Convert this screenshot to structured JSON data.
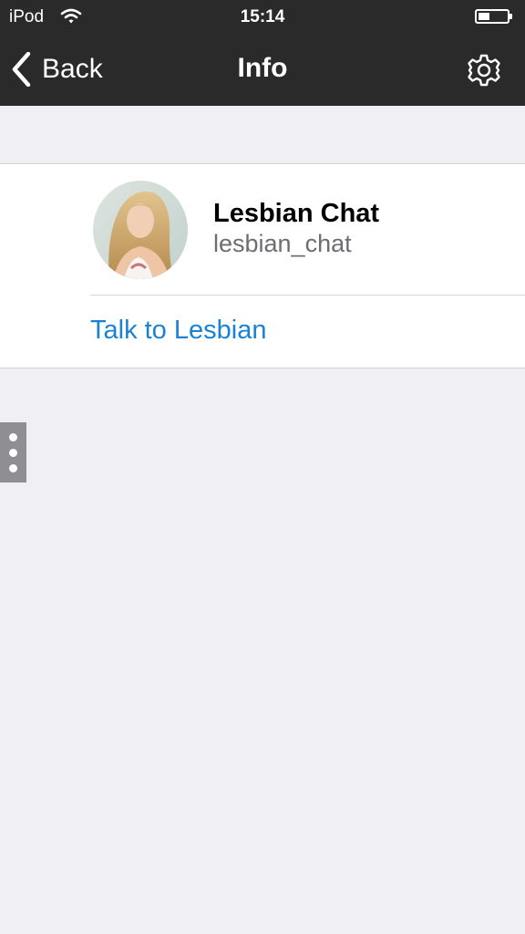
{
  "status_bar": {
    "carrier": "iPod",
    "time": "15:14",
    "battery_level": 0.4
  },
  "nav": {
    "back_label": "Back",
    "title": "Info",
    "settings_icon": "gear-icon"
  },
  "profile": {
    "name": "Lesbian Chat",
    "username": "lesbian_chat",
    "action_label": "Talk to Lesbian"
  },
  "colors": {
    "bar_background": "#2a2a2a",
    "page_background": "#efeff4",
    "link_blue": "#1a82d4",
    "secondary_text": "#6d6d72"
  }
}
